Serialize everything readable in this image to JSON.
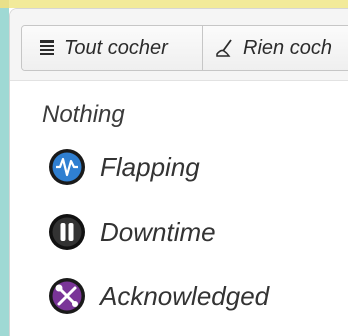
{
  "toolbar": {
    "check_all_label": "Tout cocher",
    "check_all_icon": "list-icon",
    "uncheck_all_label": "Rien coch",
    "uncheck_all_icon": "broom-icon"
  },
  "states": {
    "title": "Nothing",
    "items": [
      {
        "label": "Flapping",
        "icon": "flapping-icon",
        "color": "#1f5fa8"
      },
      {
        "label": "Downtime",
        "icon": "pause-icon",
        "color": "#2a2a2a"
      },
      {
        "label": "Acknowledged",
        "icon": "tools-icon",
        "color": "#6b2a86"
      }
    ]
  },
  "colors": {
    "frame_left": "#9fd9d4",
    "frame_top": "#f2ea9a",
    "toolbar_bg": "#f5f5f5"
  }
}
